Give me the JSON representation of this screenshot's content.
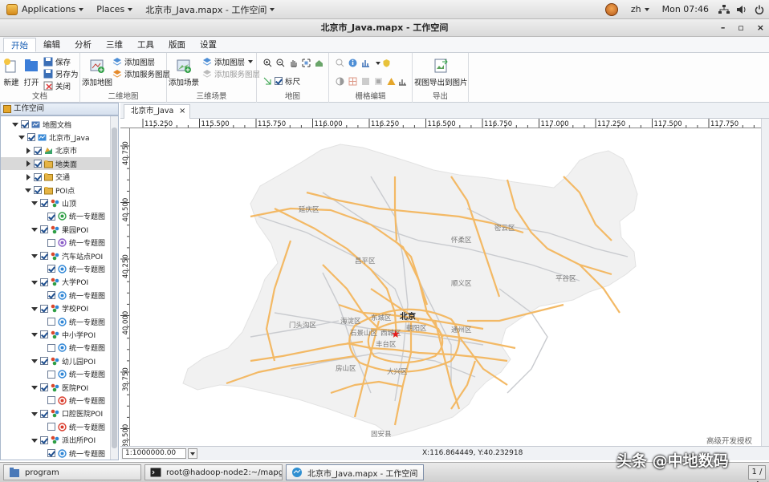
{
  "topbar": {
    "applications": "Applications",
    "places": "Places",
    "active_window": "北京市_Java.mapx - 工作空间",
    "lang": "zh",
    "clock": "Mon 07:46"
  },
  "window": {
    "title": "北京市_Java.mapx - 工作空间",
    "minimize": "–",
    "maximize": "▫",
    "close": "×"
  },
  "ribbon": {
    "tabs": [
      {
        "label": "开始"
      },
      {
        "label": "编辑"
      },
      {
        "label": "分析"
      },
      {
        "label": "三维"
      },
      {
        "label": "工具"
      },
      {
        "label": "版面"
      },
      {
        "label": "设置"
      }
    ],
    "doc_group": {
      "title": "文档",
      "new": "新建",
      "open": "打开",
      "save": "保存",
      "save_as": "另存为",
      "close": "关闭"
    },
    "map2d_group": {
      "title": "二维地图",
      "add_map": "添加地图",
      "add_layer": "添加图层",
      "add_service_layer": "添加服务图层"
    },
    "scene3d_group": {
      "title": "三维场景",
      "add_scene": "添加场景",
      "add_layer": "添加图层",
      "add_service_layer": "添加服务图层"
    },
    "map_group": {
      "title": "地图",
      "ruler": "标尺"
    },
    "raster_group": {
      "title": "栅格编辑"
    },
    "export_group": {
      "title": "导出",
      "export_view": "视图导出到图片"
    }
  },
  "workspace": {
    "title": "工作空间",
    "tree": [
      {
        "label": "地图文档",
        "checked": true,
        "toggle": "open",
        "icon": "map-doc-icon",
        "selected": false
      },
      {
        "label": "北京市_Java",
        "checked": true,
        "toggle": "open",
        "icon": "map-icon",
        "selected": false
      },
      {
        "label": "北京市",
        "checked": true,
        "toggle": "closed",
        "icon": "region-layer-icon",
        "selected": false
      },
      {
        "label": "地类面",
        "checked": true,
        "toggle": "closed",
        "icon": "folder-icon",
        "selected": true
      },
      {
        "label": "交通",
        "checked": true,
        "toggle": "closed",
        "icon": "folder-icon",
        "selected": false
      },
      {
        "label": "POI点",
        "checked": true,
        "toggle": "open",
        "icon": "folder-icon",
        "selected": false
      },
      {
        "label": "山顶",
        "checked": true,
        "toggle": "open",
        "icon": "point-layer-icon",
        "selected": false
      },
      {
        "label": "统一专题图",
        "checked": true,
        "toggle": "none",
        "icon": "theme-green-icon",
        "selected": false
      },
      {
        "label": "果园POI",
        "checked": true,
        "toggle": "open",
        "icon": "point-layer-icon",
        "selected": false
      },
      {
        "label": "统一专题图",
        "checked": false,
        "toggle": "none",
        "icon": "theme-purple-icon",
        "selected": false
      },
      {
        "label": "汽车站点POI",
        "checked": true,
        "toggle": "open",
        "icon": "point-layer-icon",
        "selected": false
      },
      {
        "label": "统一专题图",
        "checked": true,
        "toggle": "none",
        "icon": "theme-blue-icon",
        "selected": false
      },
      {
        "label": "大学POI",
        "checked": true,
        "toggle": "open",
        "icon": "point-layer-icon",
        "selected": false
      },
      {
        "label": "统一专题图",
        "checked": true,
        "toggle": "none",
        "icon": "theme-blue-icon",
        "selected": false
      },
      {
        "label": "学校POI",
        "checked": true,
        "toggle": "open",
        "icon": "point-layer-icon",
        "selected": false
      },
      {
        "label": "统一专题图",
        "checked": false,
        "toggle": "none",
        "icon": "theme-blue-icon",
        "selected": false
      },
      {
        "label": "中小学POI",
        "checked": true,
        "toggle": "open",
        "icon": "point-layer-icon",
        "selected": false
      },
      {
        "label": "统一专题图",
        "checked": false,
        "toggle": "none",
        "icon": "theme-blue-icon",
        "selected": false
      },
      {
        "label": "幼儿园POI",
        "checked": true,
        "toggle": "open",
        "icon": "point-layer-icon",
        "selected": false
      },
      {
        "label": "统一专题图",
        "checked": false,
        "toggle": "none",
        "icon": "theme-blue-icon",
        "selected": false
      },
      {
        "label": "医院POI",
        "checked": true,
        "toggle": "open",
        "icon": "point-layer-icon",
        "selected": false
      },
      {
        "label": "统一专题图",
        "checked": false,
        "toggle": "none",
        "icon": "theme-red-icon",
        "selected": false
      },
      {
        "label": "口腔医院POI",
        "checked": true,
        "toggle": "open",
        "icon": "point-layer-icon",
        "selected": false
      },
      {
        "label": "统一专题图",
        "checked": false,
        "toggle": "none",
        "icon": "theme-red-icon",
        "selected": false
      },
      {
        "label": "派出所POI",
        "checked": true,
        "toggle": "open",
        "icon": "point-layer-icon",
        "selected": false
      },
      {
        "label": "统一专题图",
        "checked": true,
        "toggle": "none",
        "icon": "theme-blue-icon",
        "selected": false
      }
    ]
  },
  "map_view": {
    "tab_label": "北京市_Java",
    "x_ticks": [
      "115.250",
      "115.500",
      "115.750",
      "116.000",
      "116.250",
      "116.500",
      "116.750",
      "117.000",
      "117.250",
      "117.500",
      "117.750"
    ],
    "y_ticks": [
      "40.750",
      "40.500",
      "40.250",
      "40.000",
      "39.750",
      "39.500"
    ],
    "district_labels": [
      "延庆区",
      "怀柔区",
      "密云区",
      "昌平区",
      "顺义区",
      "平谷区",
      "门头沟区",
      "海淀区",
      "东城区",
      "北京",
      "朝阳区",
      "石景山区",
      "西城区",
      "丰台区",
      "通州区",
      "房山区",
      "大兴区",
      "固安县"
    ],
    "marker": "★",
    "colors": {
      "boundary_fill": "#f1f1f1",
      "major_road": "#f3b965",
      "minor_road": "#c9cbcf",
      "marker": "#e41a1c"
    }
  },
  "status": {
    "scale": "1:1000000.00",
    "coords": "X:116.864449,  Y:40.232918"
  },
  "watermarks": {
    "small": "高级开发授权",
    "big": "头条 @中地数码"
  },
  "taskbar": {
    "items": [
      {
        "label": "program"
      },
      {
        "label": "root@hadoop-node2:~/mapgis10/pr..."
      },
      {
        "label": "北京市_Java.mapx - 工作空间"
      }
    ],
    "pager": "1 / 4"
  }
}
